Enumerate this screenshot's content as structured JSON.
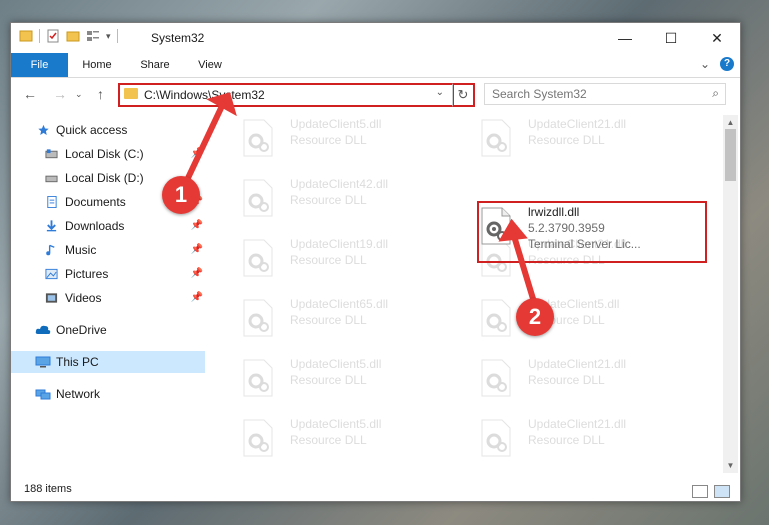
{
  "window": {
    "title": "System32",
    "controls": {
      "minimize": "—",
      "maximize": "☐",
      "close": "✕"
    }
  },
  "ribbon": {
    "tabs": [
      "File",
      "Home",
      "Share",
      "View"
    ],
    "expand_glyph": "⌄",
    "help_glyph": "?"
  },
  "navigation": {
    "back": "←",
    "forward": "→",
    "up": "↑",
    "history": "⌄",
    "address": "C:\\Windows\\System32",
    "dropdown": "⌄",
    "refresh": "↻",
    "search_placeholder": "Search System32",
    "search_icon": "⌕"
  },
  "sidebar": {
    "items": [
      {
        "label": "Quick access",
        "icon": "star-icon",
        "pinned": false
      },
      {
        "label": "Local Disk (C:)",
        "icon": "drive-icon",
        "pinned": true
      },
      {
        "label": "Local Disk (D:)",
        "icon": "drive-icon",
        "pinned": false
      },
      {
        "label": "Documents",
        "icon": "documents-icon",
        "pinned": true
      },
      {
        "label": "Downloads",
        "icon": "downloads-icon",
        "pinned": true
      },
      {
        "label": "Music",
        "icon": "music-icon",
        "pinned": true
      },
      {
        "label": "Pictures",
        "icon": "pictures-icon",
        "pinned": true
      },
      {
        "label": "Videos",
        "icon": "videos-icon",
        "pinned": true
      },
      {
        "label": "OneDrive",
        "icon": "cloud-icon",
        "pinned": false
      },
      {
        "label": "This PC",
        "icon": "computer-icon",
        "pinned": false,
        "selected": true
      },
      {
        "label": "Network",
        "icon": "network-icon",
        "pinned": false
      }
    ],
    "pin_glyph": "📌"
  },
  "files": {
    "left_column": [
      {
        "name": "UpdateClient5.dll",
        "desc": "Resource DLL"
      },
      {
        "name": "UpdateClient42.dll",
        "desc": "Resource DLL"
      },
      {
        "name": "UpdateClient19.dll",
        "desc": "Resource DLL"
      },
      {
        "name": "UpdateClient65.dll",
        "desc": "Resource DLL"
      },
      {
        "name": "UpdateClient5.dll",
        "desc": "Resource DLL"
      },
      {
        "name": "UpdateClient5.dll",
        "desc": "Resource DLL"
      }
    ],
    "right_column": [
      {
        "name": "UpdateClient21.dll",
        "desc": "Resource DLL"
      },
      {
        "name": "UpdateClient21.dll",
        "desc": "Resource DLL"
      },
      {
        "name": "UpdateClient5.dll",
        "desc": "Resource DLL"
      },
      {
        "name": "UpdateClient21.dll",
        "desc": "Resource DLL"
      },
      {
        "name": "UpdateClient21.dll",
        "desc": "Resource DLL"
      }
    ],
    "highlighted": {
      "name": "lrwizdll.dll",
      "version": "5.2.3790.3959",
      "desc": "Terminal Server Lic..."
    }
  },
  "statusbar": {
    "item_count": "188 items"
  },
  "annotations": {
    "step1": "1",
    "step2": "2",
    "accent_color": "#e53935"
  }
}
